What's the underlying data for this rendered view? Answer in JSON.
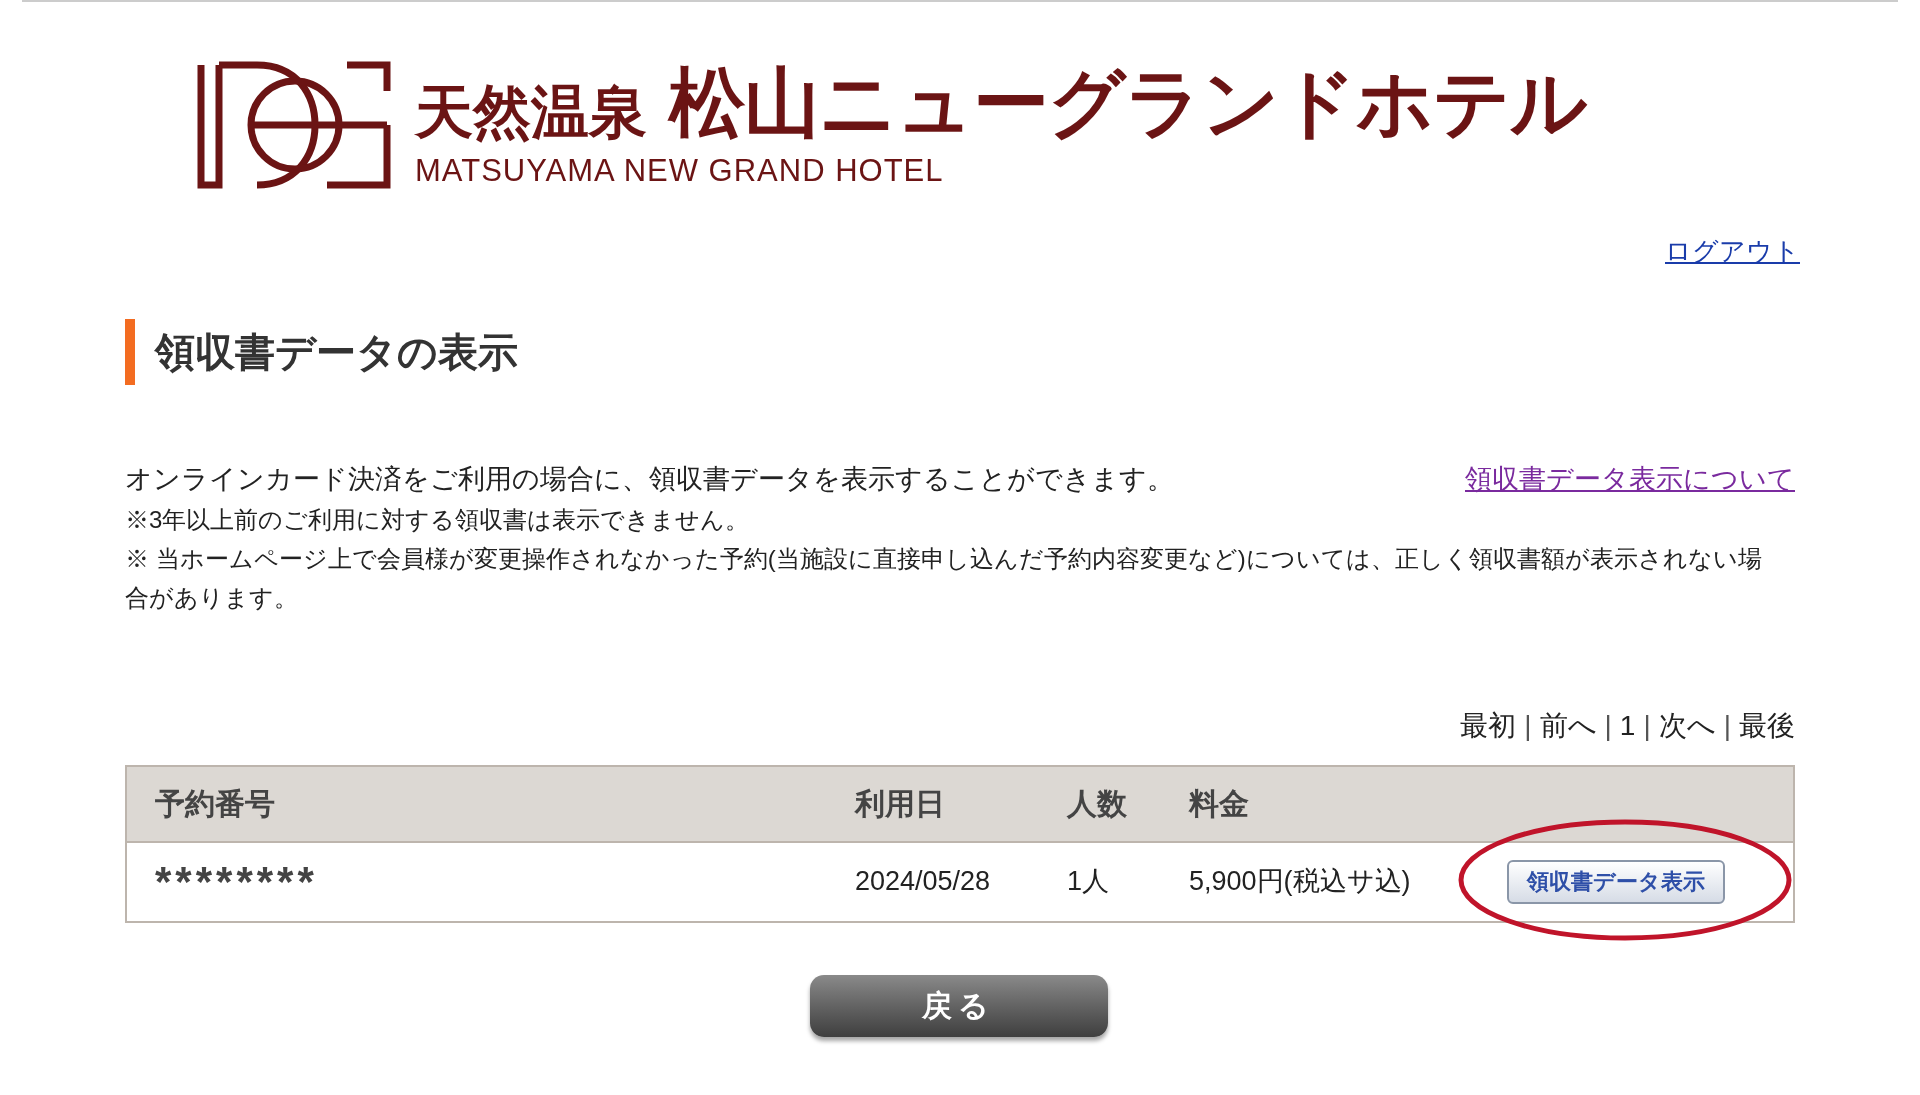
{
  "logo": {
    "tagline": "天然温泉",
    "name": "松山ニューグランドホテル",
    "name_en": "MATSUYAMA NEW GRAND HOTEL"
  },
  "logout": "ログアウト",
  "heading": "領収書データの表示",
  "intro": "オンラインカード決済をご利用の場合に、領収書データを表示することができます。",
  "help_link": "領収書データ表示について",
  "notes": [
    "※3年以上前のご利用に対する領収書は表示できません。",
    "※ 当ホームページ上で会員様が変更操作されなかった予約(当施設に直接申し込んだ予約内容変更など)については、正しく領収書額が表示されない場合があります。"
  ],
  "pagination": [
    {
      "kind": "link",
      "label": "最初"
    },
    {
      "kind": "separator",
      "label": "|"
    },
    {
      "kind": "link",
      "label": "前へ"
    },
    {
      "kind": "separator",
      "label": "|"
    },
    {
      "kind": "link",
      "label": "1"
    },
    {
      "kind": "separator",
      "label": "|"
    },
    {
      "kind": "link",
      "label": "次へ"
    },
    {
      "kind": "separator",
      "label": "|"
    },
    {
      "kind": "link",
      "label": "最後"
    }
  ],
  "table": {
    "columns": [
      "予約番号",
      "利用日",
      "人数",
      "料金"
    ],
    "rows": [
      {
        "cells": [
          "********",
          "2024/05/28",
          "1人",
          "5,900円(税込サ込)"
        ],
        "button": "領収書データ表示",
        "circled": true
      }
    ]
  },
  "back_button": "戻る"
}
